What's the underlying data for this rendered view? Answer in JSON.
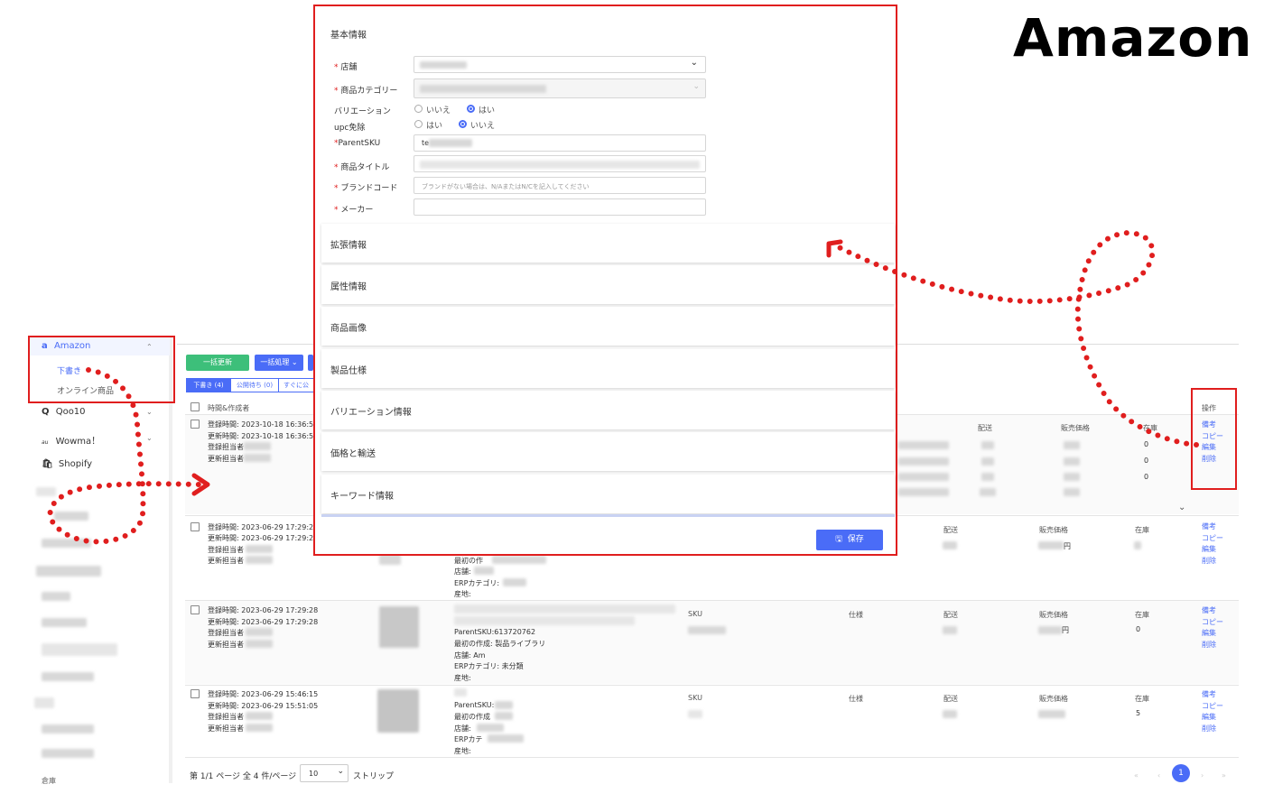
{
  "brand": "Amazon",
  "sidebar": {
    "amazon": "Amazon",
    "drafts": "下書き",
    "online": "オンライン商品",
    "qoo10": "Qoo10",
    "wowma": "Wowma！",
    "shopify": "Shopify",
    "bottom": "倉庫"
  },
  "toolbar": {
    "bulk_update": "一括更新",
    "bulk_process": "一括処理"
  },
  "tabs": {
    "draft": "下書き (4)",
    "pending": "公開待ち (0)",
    "now": "すぐに公"
  },
  "table": {
    "col_time": "時間&作成者",
    "col_ops": "操作",
    "col_sku": "SKU",
    "col_spec": "仕様",
    "col_ship": "配送",
    "col_price": "販売価格",
    "col_stock": "在庫",
    "rows": [
      {
        "reg": "登録時間: 2023-10-18 16:36:59",
        "upd": "更新時間: 2023-10-18 16:36:59",
        "reg_user": "登録担当者",
        "upd_user": "更新担当者",
        "stock": [
          "0",
          "0",
          "0"
        ]
      },
      {
        "reg": "登録時間: 2023-06-29 17:29:28",
        "upd": "更新時間: 2023-06-29 17:29:28",
        "reg_user": "登録担当者",
        "upd_user": "更新担当者",
        "info": [
          "最初の作",
          "店舗:",
          "ERPカテゴリ:",
          "産地:"
        ]
      },
      {
        "reg": "登録時間: 2023-06-29 17:29:28",
        "upd": "更新時間: 2023-06-29 17:29:28",
        "reg_user": "登録担当者",
        "upd_user": "更新担当者",
        "info": [
          "ParentSKU:613720762",
          "最初の作成: 製品ライブラリ",
          "店舗: Am",
          "ERPカテゴリ: 未分類",
          "産地:"
        ],
        "stock": "0",
        "price_suffix": "円"
      },
      {
        "reg": "登録時間: 2023-06-29 15:46:15",
        "upd": "更新時間: 2023-06-29 15:51:05",
        "reg_user": "登録担当者",
        "upd_user": "更新担当者",
        "info": [
          "ParentSKU:",
          "最初の作成",
          "店舗:",
          "ERPカテ",
          "産地:"
        ],
        "stock": "5"
      }
    ],
    "ops": [
      "備考",
      "コピー",
      "編集",
      "削除"
    ],
    "row2_price_suffix": "円"
  },
  "pagination": {
    "summary": "第 1/1 ページ 全 4 件/ページ",
    "per_page": "10",
    "strip": "ストリップ",
    "current": "1"
  },
  "modal": {
    "basic_info": "基本情報",
    "store_label": "店舗",
    "category_label": "商品カテゴリー",
    "variation_label": "バリエーション",
    "variation_no": "いいえ",
    "variation_yes": "はい",
    "variation_value": "はい",
    "upc_label": "upc免除",
    "upc_yes": "はい",
    "upc_no": "いいえ",
    "upc_value": "いいえ",
    "parent_sku_label": "ParentSKU",
    "parent_sku_value": "te",
    "title_label": "商品タイトル",
    "brand_label": "ブランドコード",
    "brand_placeholder": "ブランドがない場合は、N/AまたはN/Cを記入してください",
    "maker_label": "メーカー",
    "sections": [
      "拡張情報",
      "属性情報",
      "商品画像",
      "製品仕様",
      "バリエーション情報",
      "価格と輸送",
      "キーワード情報"
    ],
    "save": "保存"
  },
  "colors": {
    "accent": "#4a6cf7",
    "highlight": "#e01e1e",
    "green": "#3dbf7a"
  }
}
